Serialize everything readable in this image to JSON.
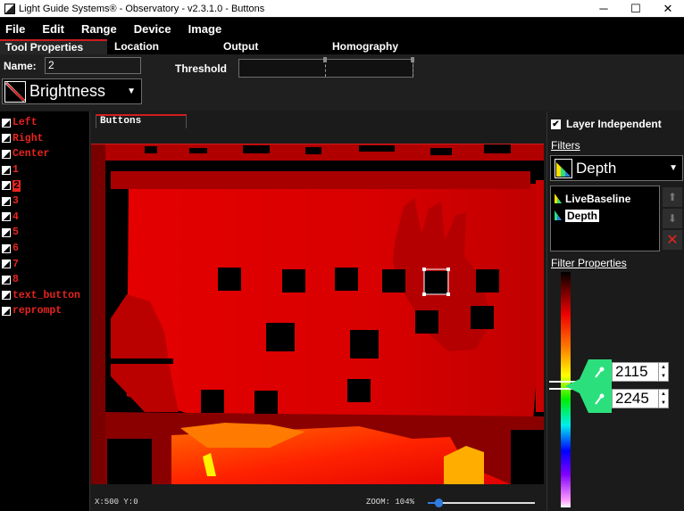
{
  "window": {
    "title": "Light Guide Systems® - Observatory - v2.3.1.0 - Buttons",
    "controls": {
      "minimize": "─",
      "maximize": "☐",
      "close": "✕"
    }
  },
  "menu": {
    "items": [
      "File",
      "Edit",
      "Range",
      "Device",
      "Image"
    ]
  },
  "tabs": [
    "Tool Properties",
    "Location",
    "Output",
    "Homography"
  ],
  "properties": {
    "name_label": "Name:",
    "name_value": "2",
    "threshold_label": "Threshold",
    "tool_type": "Brightness"
  },
  "tools": {
    "items": [
      "Left",
      "Right",
      "Center",
      "1",
      "2",
      "3",
      "4",
      "5",
      "6",
      "7",
      "8",
      "text_button",
      "reprompt"
    ],
    "selected": "2"
  },
  "center": {
    "tab": "Buttons",
    "status": {
      "coords": "X:500 Y:0",
      "zoom": "ZOOM: 104%"
    },
    "zoom_level_fraction": 0.1
  },
  "right_panel": {
    "layer_independent_label": "Layer Independent",
    "layer_independent_checked": true,
    "filters_label": "Filters",
    "filter_type": "Depth",
    "filter_list": [
      "LiveBaseline",
      "Depth"
    ],
    "filter_selected": "Depth",
    "filter_properties_label": "Filter Properties",
    "range_min": "2115",
    "range_max": "2245"
  },
  "colors": {
    "accent_red": "#d21c1c",
    "list_text_red": "#e8241e",
    "range_green": "#2be07c",
    "zoom_blue": "#2f7ce0"
  }
}
